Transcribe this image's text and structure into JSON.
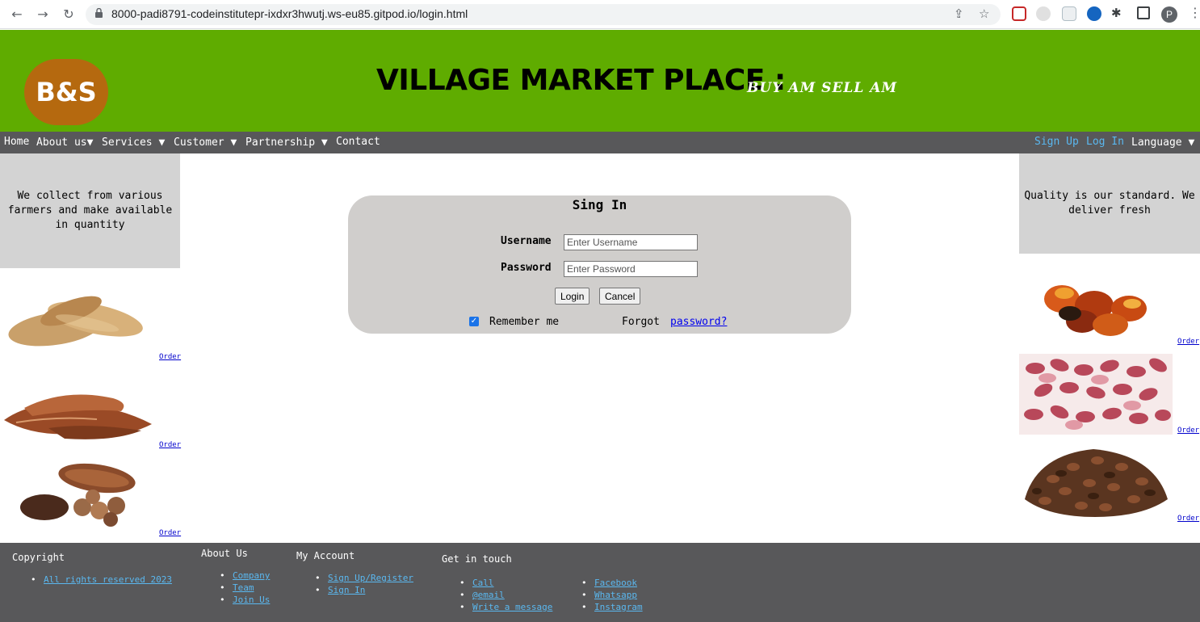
{
  "browser": {
    "url": "8000-padi8791-codeinstitutepr-ixdxr3hwutj.ws-eu85.gitpod.io/login.html",
    "profile_initial": "P"
  },
  "header": {
    "logo_text": "B&S",
    "title": "VILLAGE MARKET PLACE :",
    "tagline": "BUY AM SELL AM",
    "bg_color": "#5fac00",
    "logo_color": "#b5690f"
  },
  "nav": {
    "home": "Home",
    "about": "About us▼",
    "services": "Services ▼",
    "customer": "Customer ▼",
    "partnership": "Partnership ▼",
    "contact": "Contact",
    "signup": "Sign Up",
    "login": "Log In",
    "language": "Language ▼"
  },
  "left_panel": {
    "message": "We collect from various farmers and make available in quantity",
    "products": [
      {
        "name": "sweet-potatoes",
        "order_label": "Order"
      },
      {
        "name": "dried-yams",
        "order_label": "Order"
      },
      {
        "name": "cocoa-pods",
        "order_label": "Order"
      }
    ]
  },
  "right_panel": {
    "message": "Quality is our standard. We deliver fresh",
    "products": [
      {
        "name": "palm-fruits",
        "order_label": "Order"
      },
      {
        "name": "red-kidney-beans",
        "order_label": "Order"
      },
      {
        "name": "coffee-beans",
        "order_label": "Order"
      }
    ]
  },
  "login": {
    "title": "Sing In",
    "username_label": "Username",
    "username_placeholder": "Enter Username",
    "password_label": "Password",
    "password_placeholder": "Enter Password",
    "login_button": "Login",
    "cancel_button": "Cancel",
    "remember_label": "Remember me",
    "remember_checked": true,
    "forgot_text": "Forgot",
    "forgot_link": "password?"
  },
  "footer": {
    "copyright": {
      "heading": "Copyright",
      "items": [
        "All rights reserved 2023"
      ]
    },
    "about": {
      "heading": "About Us",
      "items": [
        "Company",
        "Team",
        "Join Us"
      ]
    },
    "account": {
      "heading": "My Account",
      "items": [
        "Sign Up/Register",
        "Sign In"
      ]
    },
    "contact": {
      "heading": "Get in touch",
      "items_left": [
        "Call",
        "@email",
        "Write a message"
      ],
      "items_right": [
        "Facebook",
        "Whatsapp",
        "Instagram"
      ]
    }
  }
}
